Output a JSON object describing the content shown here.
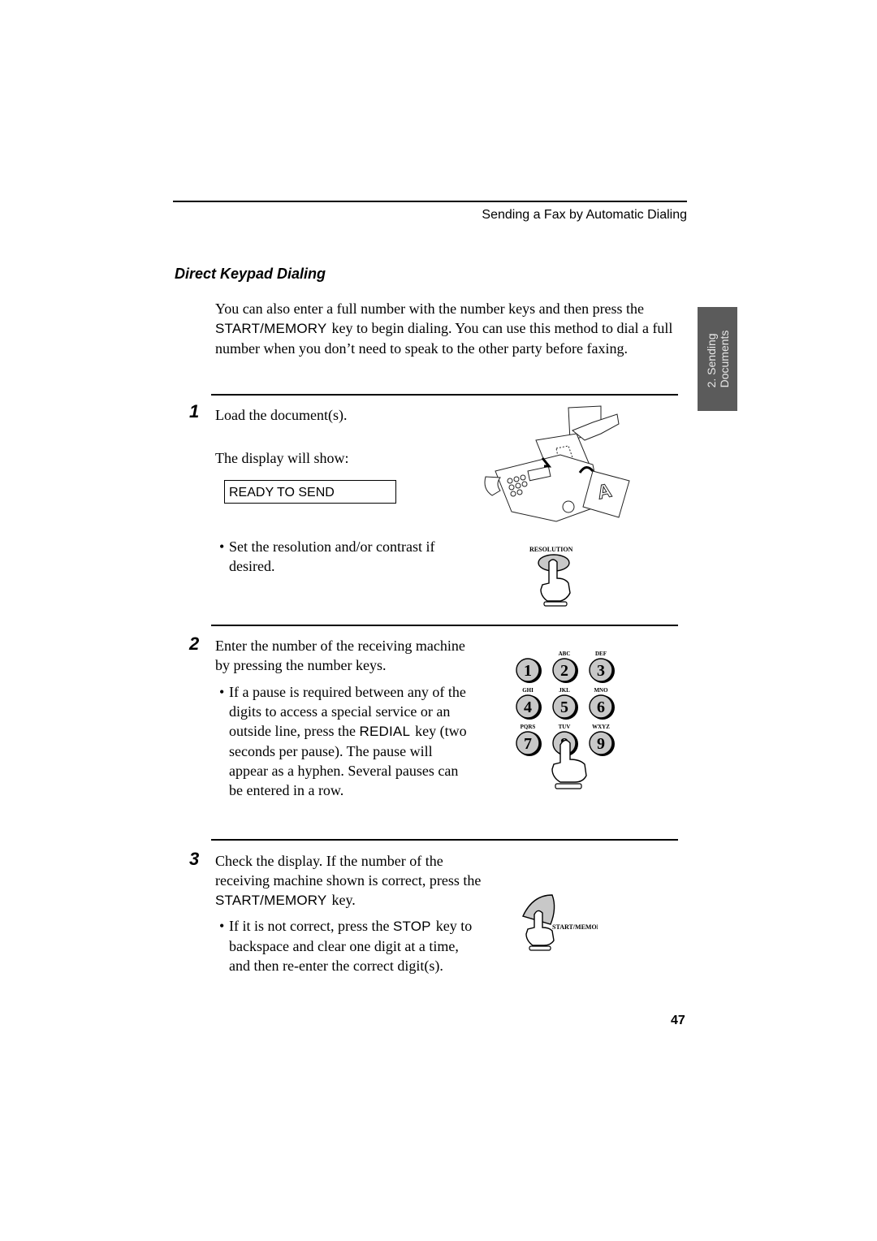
{
  "header": {
    "running_title": "Sending a Fax by Automatic Dialing"
  },
  "side_tab": {
    "line1": "2. Sending",
    "line2": "Documents"
  },
  "section": {
    "title": "Direct Keypad Dialing",
    "intro": {
      "part1": "You can also enter a full number with the number keys and then press the ",
      "key": "START/MEMORY",
      "part2": "key to begin dialing. You can use this method to dial a full number when you don’t need to speak to the other party before faxing."
    }
  },
  "steps": [
    {
      "number": "1",
      "text": "Load the document(s).",
      "subtext": "The display will show:",
      "display": "READY TO SEND",
      "bullet": "Set the resolution and/or contrast if desired.",
      "illustration_label": "RESOLUTION"
    },
    {
      "number": "2",
      "text": "Enter the number of the receiving machine by pressing the number keys.",
      "bullet_part1": "If a pause is required between any of the digits to access a special service or an outside line, press the ",
      "bullet_key": "REDIAL",
      "bullet_part2": "key (two seconds per pause). The pause will appear as a hyphen. Several pauses can be entered in a row.",
      "keypad": [
        {
          "digit": "1",
          "letters": ""
        },
        {
          "digit": "2",
          "letters": "ABC"
        },
        {
          "digit": "3",
          "letters": "DEF"
        },
        {
          "digit": "4",
          "letters": "GHI"
        },
        {
          "digit": "5",
          "letters": "JKL"
        },
        {
          "digit": "6",
          "letters": "MNO"
        },
        {
          "digit": "7",
          "letters": "PQRS"
        },
        {
          "digit": "8",
          "letters": "TUV"
        },
        {
          "digit": "9",
          "letters": "WXYZ"
        }
      ]
    },
    {
      "number": "3",
      "text_part1": "Check the display. If the number of the receiving machine shown is correct, press the ",
      "text_key": "START/MEMORY",
      "text_part2": "key.",
      "bullet_part1": "If it is not correct, press the ",
      "bullet_key": "STOP",
      "bullet_part2": "key to backspace and clear one digit at a time, and then re-enter the correct digit(s).",
      "illustration_label": "START/MEMORY"
    }
  ],
  "footer": {
    "page_number": "47"
  },
  "colors": {
    "side_tab_bg": "#5b5b5b",
    "key_fill": "#c8c8c8"
  }
}
